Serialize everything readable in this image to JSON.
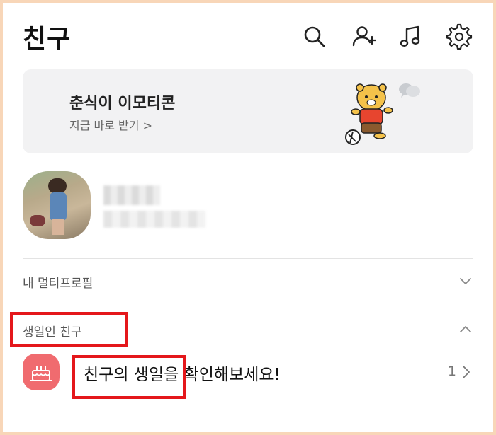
{
  "header": {
    "title": "친구",
    "icons": [
      "search-icon",
      "add-friend-icon",
      "music-icon",
      "settings-icon"
    ]
  },
  "banner": {
    "title": "춘식이 이모티콘",
    "subtitle": "지금 바로 받기 >"
  },
  "sections": {
    "multi_profile": "내 멀티프로필",
    "birthday": "생일인 친구"
  },
  "birthday_item": {
    "text": "친구의 생일을 확인해보세요!",
    "count": "1"
  },
  "colors": {
    "highlight": "#e4171b",
    "birthday_icon_bg": "#f06b6f",
    "banner_bg": "#f2f2f3"
  }
}
